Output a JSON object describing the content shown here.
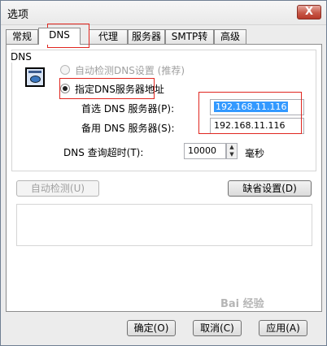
{
  "window": {
    "title": "选项",
    "close_label": "X"
  },
  "tabs": [
    {
      "label": "常规"
    },
    {
      "label": "DNS"
    },
    {
      "label": "代理"
    },
    {
      "label": "服务器"
    },
    {
      "label": "SMTP转投"
    },
    {
      "label": "高级"
    }
  ],
  "dns": {
    "group_label": "DNS",
    "auto_option": "自动检测DNS设置 (推荐)",
    "manual_option": "指定DNS服务器地址",
    "primary_label": "首选 DNS 服务器(P):",
    "primary_value": "192.168.11.116",
    "secondary_label": "备用 DNS 服务器(S):",
    "secondary_value": "192.168.11.116",
    "timeout_label": "DNS 查询超时(T):",
    "timeout_value": "10000",
    "timeout_unit": "毫秒"
  },
  "buttons": {
    "auto_detect": "自动检测(U)",
    "defaults": "缺省设置(D)",
    "ok": "确定(O)",
    "cancel": "取消(C)",
    "apply": "应用(A)"
  },
  "watermark": "Bai 经验"
}
